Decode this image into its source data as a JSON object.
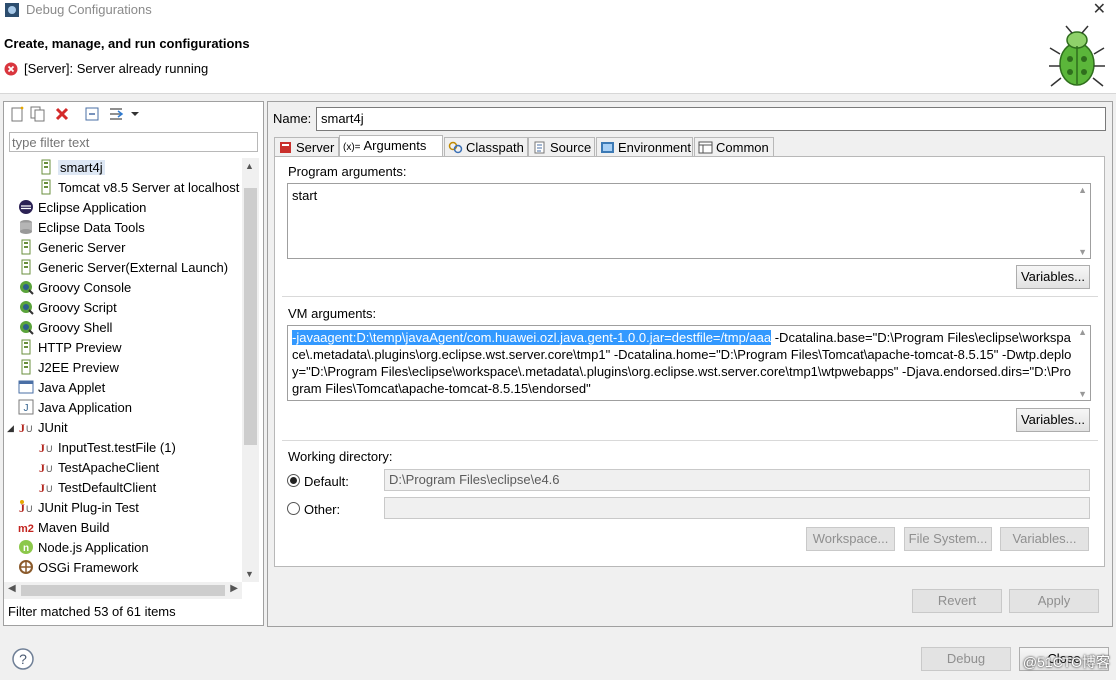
{
  "window": {
    "title": "Debug Configurations",
    "close_label": "✕"
  },
  "header": {
    "heading": "Create, manage, and run configurations",
    "message": "[Server]: Server already running"
  },
  "left_panel": {
    "filter_placeholder": "type filter text",
    "tree": [
      {
        "label": "smart4j",
        "indent": 2,
        "icon": "server-config-icon",
        "selected": true
      },
      {
        "label": "Tomcat v8.5 Server at localhost",
        "indent": 2,
        "icon": "server-config-icon"
      },
      {
        "label": "Eclipse Application",
        "indent": 1,
        "icon": "eclipse-icon"
      },
      {
        "label": "Eclipse Data Tools",
        "indent": 1,
        "icon": "database-icon"
      },
      {
        "label": "Generic Server",
        "indent": 1,
        "icon": "server-icon"
      },
      {
        "label": "Generic Server(External Launch)",
        "indent": 1,
        "icon": "server-icon"
      },
      {
        "label": "Groovy Console",
        "indent": 1,
        "icon": "groovy-icon"
      },
      {
        "label": "Groovy Script",
        "indent": 1,
        "icon": "groovy-icon"
      },
      {
        "label": "Groovy Shell",
        "indent": 1,
        "icon": "groovy-icon"
      },
      {
        "label": "HTTP Preview",
        "indent": 1,
        "icon": "server-icon"
      },
      {
        "label": "J2EE Preview",
        "indent": 1,
        "icon": "server-icon"
      },
      {
        "label": "Java Applet",
        "indent": 1,
        "icon": "applet-icon"
      },
      {
        "label": "Java Application",
        "indent": 1,
        "icon": "java-app-icon"
      },
      {
        "label": "JUnit",
        "indent": 1,
        "icon": "junit-icon",
        "expanded": true
      },
      {
        "label": "InputTest.testFile (1)",
        "indent": 2,
        "icon": "junit-icon"
      },
      {
        "label": "TestApacheClient",
        "indent": 2,
        "icon": "junit-icon"
      },
      {
        "label": "TestDefaultClient",
        "indent": 2,
        "icon": "junit-icon"
      },
      {
        "label": "JUnit Plug-in Test",
        "indent": 1,
        "icon": "junit-plugin-icon"
      },
      {
        "label": "Maven Build",
        "indent": 1,
        "icon": "maven-icon"
      },
      {
        "label": "Node.js Application",
        "indent": 1,
        "icon": "nodejs-icon"
      },
      {
        "label": "OSGi Framework",
        "indent": 1,
        "icon": "osgi-icon"
      }
    ],
    "status": "Filter matched 53 of 61 items"
  },
  "config": {
    "name_label": "Name:",
    "name_value": "smart4j",
    "tabs": [
      {
        "label": "Server",
        "icon": "server-tab-icon"
      },
      {
        "label": "Arguments",
        "icon": "arguments-icon",
        "active": true
      },
      {
        "label": "Classpath",
        "icon": "classpath-icon"
      },
      {
        "label": "Source",
        "icon": "source-icon"
      },
      {
        "label": "Environment",
        "icon": "environment-icon"
      },
      {
        "label": "Common",
        "icon": "common-icon"
      }
    ],
    "program_args_label": "Program arguments:",
    "program_args_value": "start",
    "vm_args_label": "VM arguments:",
    "vm_args_selected": "-javaagent:D:\\temp\\javaAgent/com.huawei.ozl.java.gent-1.0.0.jar=destfile=/tmp/aaa",
    "vm_args_rest": " -Dcatalina.base=\"D:\\Program Files\\eclipse\\workspace\\.metadata\\.plugins\\org.eclipse.wst.server.core\\tmp1\" -Dcatalina.home=\"D:\\Program Files\\Tomcat\\apache-tomcat-8.5.15\" -Dwtp.deploy=\"D:\\Program Files\\eclipse\\workspace\\.metadata\\.plugins\\org.eclipse.wst.server.core\\tmp1\\wtpwebapps\" -Djava.endorsed.dirs=\"D:\\Program Files\\Tomcat\\apache-tomcat-8.5.15\\endorsed\"",
    "variables_label": "Variables...",
    "working_dir_label": "Working directory:",
    "default_label": "Default:",
    "default_value": "D:\\Program Files\\eclipse\\e4.6",
    "other_label": "Other:",
    "other_value": "",
    "workspace_label": "Workspace...",
    "filesystem_label": "File System...",
    "revert_label": "Revert",
    "apply_label": "Apply"
  },
  "footer": {
    "debug_label": "Debug",
    "close_label": "Close",
    "watermark": "@51CTO博客"
  }
}
